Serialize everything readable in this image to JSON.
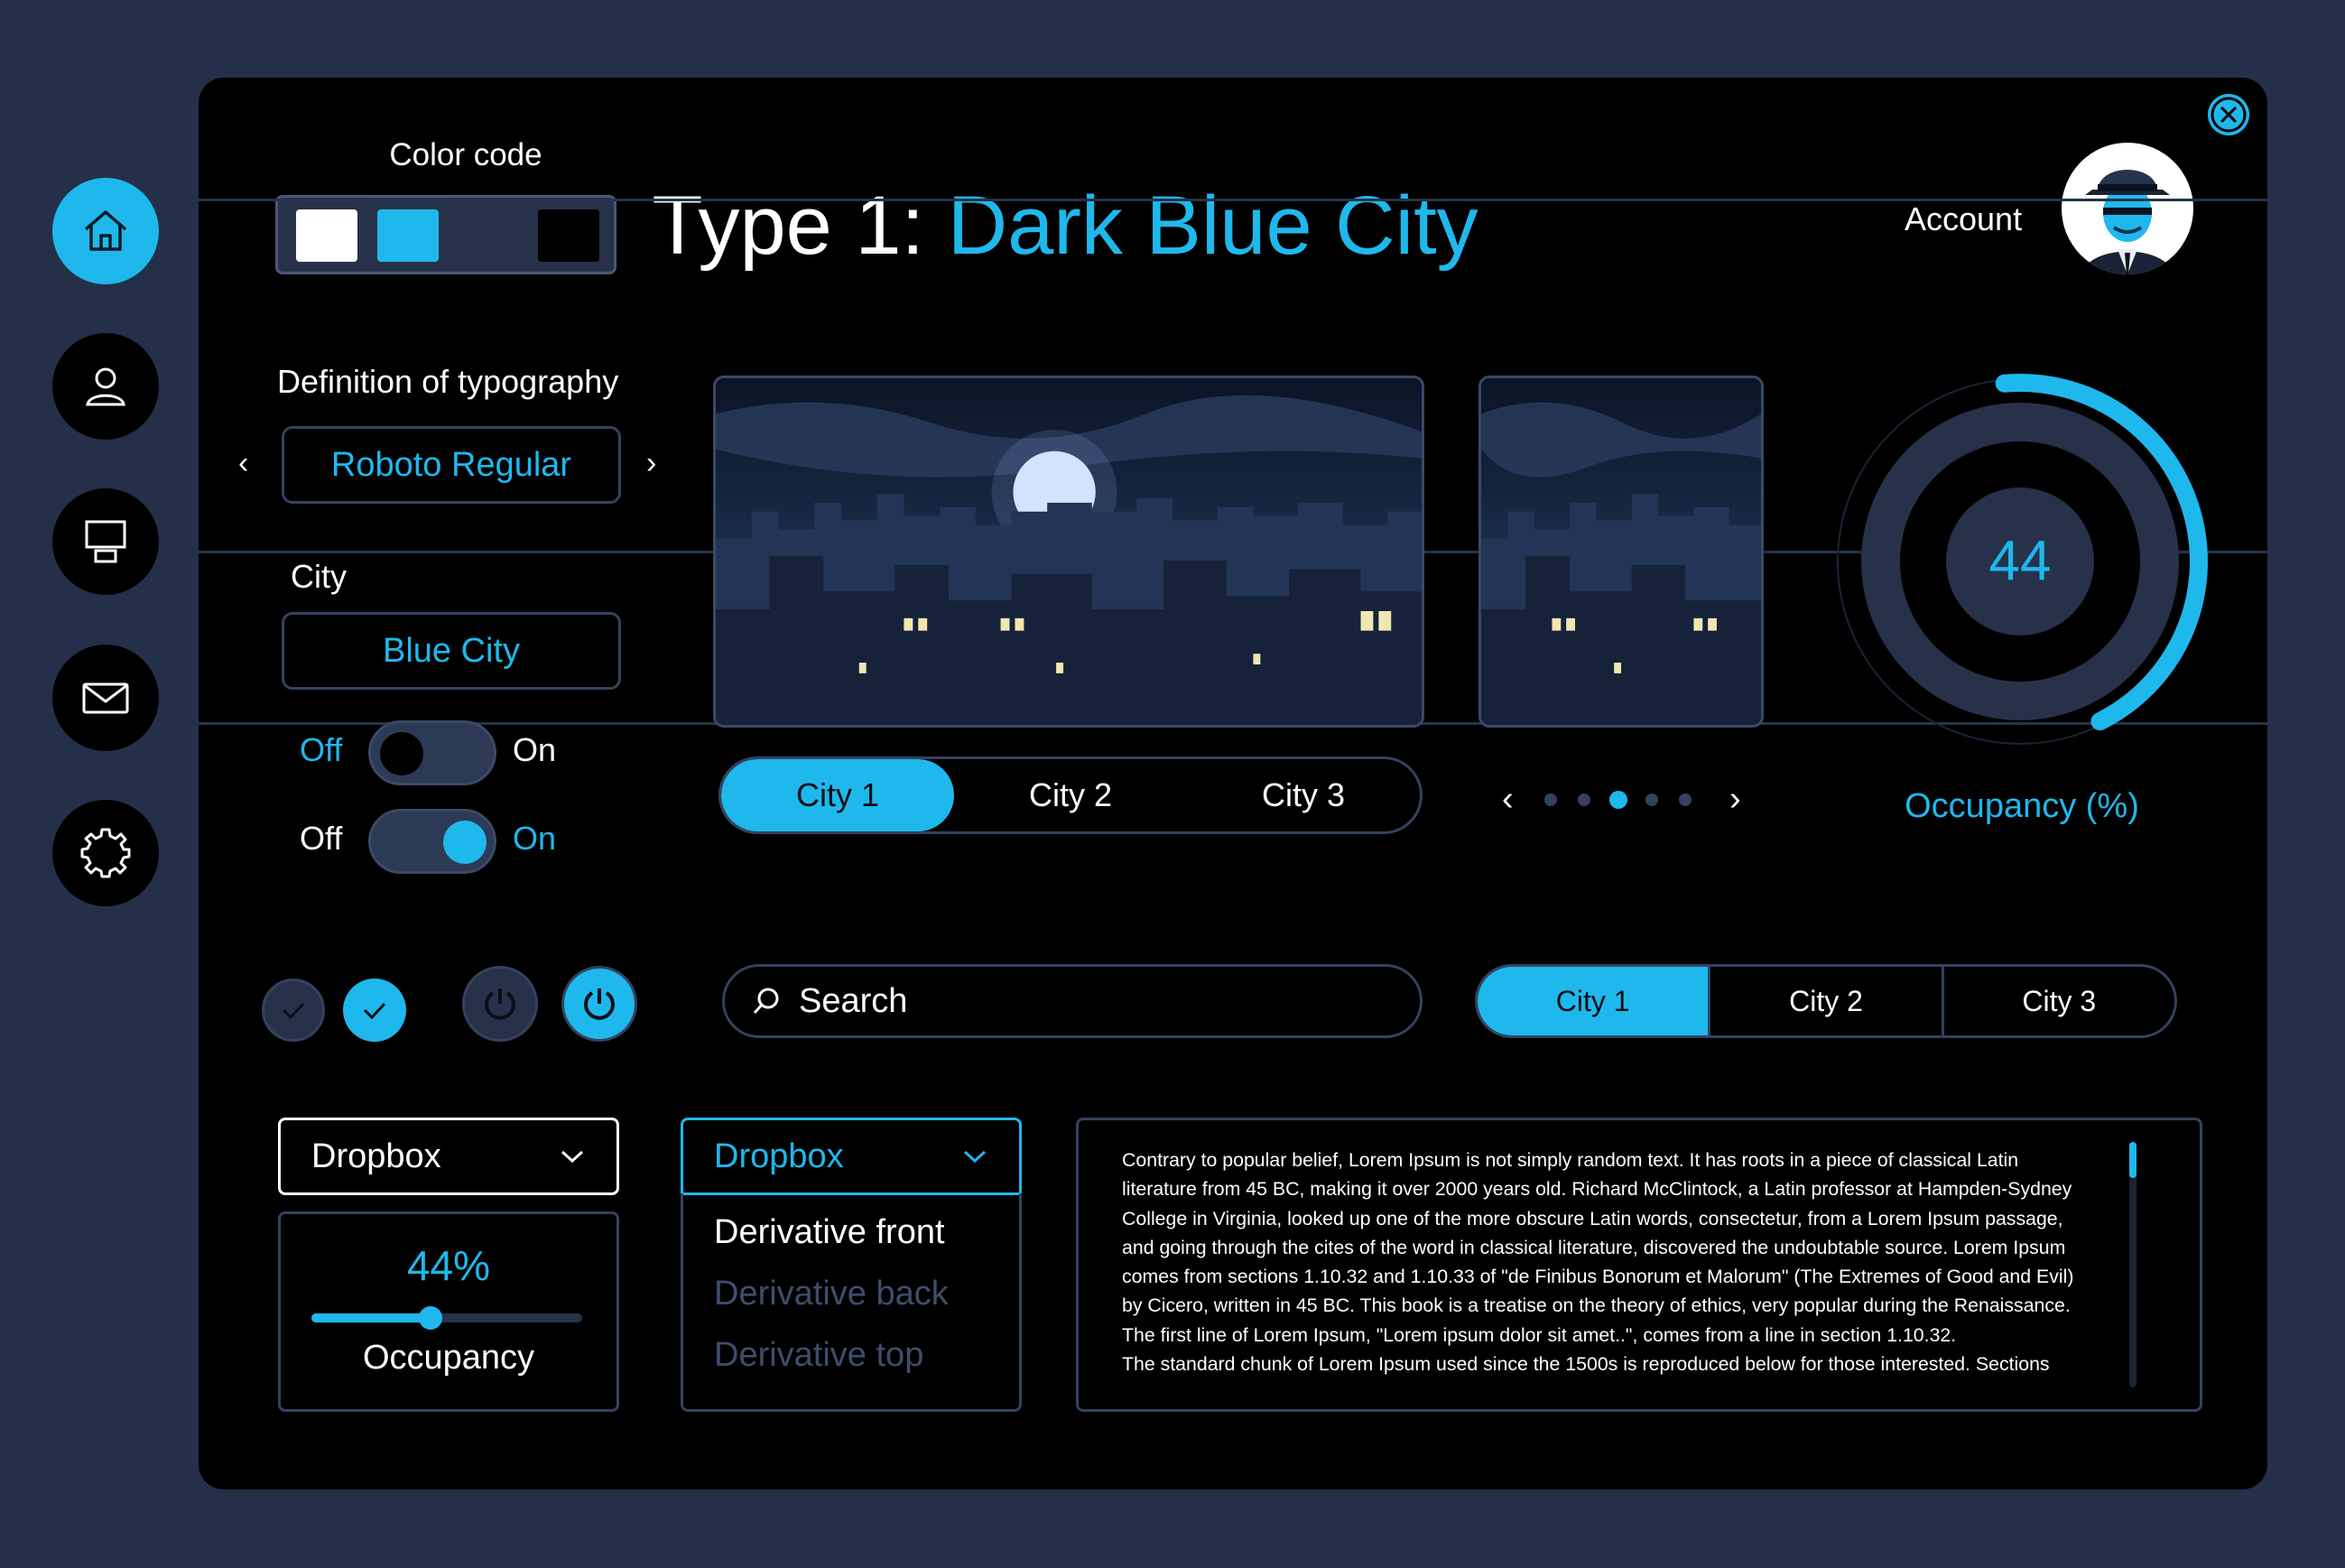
{
  "colors": {
    "accent": "#1fb8ec",
    "background": "#24304a",
    "panel": "#000000",
    "muted": "#34425e"
  },
  "sidebar": {
    "items": [
      {
        "name": "home",
        "icon": "home-icon",
        "active": true
      },
      {
        "name": "profile",
        "icon": "user-icon",
        "active": false
      },
      {
        "name": "presentation",
        "icon": "presentation-icon",
        "active": false
      },
      {
        "name": "mail",
        "icon": "mail-icon",
        "active": false
      },
      {
        "name": "settings",
        "icon": "gear-icon",
        "active": false
      }
    ]
  },
  "header": {
    "color_code_label": "Color code",
    "color_swatches": [
      "#ffffff",
      "#1fb8ec",
      "#1f2a3f",
      "#000000"
    ],
    "title_prefix": "Type 1: ",
    "title_accent": "Dark Blue City",
    "account_label": "Account"
  },
  "typography": {
    "label": "Definition of typography",
    "value": "Roboto Regular",
    "city_label": "City",
    "city_value": "Blue City"
  },
  "toggles": [
    {
      "off": "Off",
      "on": "On",
      "state": false
    },
    {
      "off": "Off",
      "on": "On",
      "state": true
    }
  ],
  "gallery": {
    "tabs": [
      "City 1",
      "City 2",
      "City 3"
    ],
    "active_tab": 0,
    "carousel_dots": 5,
    "carousel_active": 2
  },
  "occupancy_ring": {
    "value": "44",
    "percent": 44,
    "label": "Occupancy (%)"
  },
  "search": {
    "placeholder": "Search"
  },
  "segment_tabs": {
    "tabs": [
      "City 1",
      "City 2",
      "City 3"
    ],
    "active": 0
  },
  "dropbox1": {
    "label": "Dropbox"
  },
  "dropbox2": {
    "label": "Dropbox",
    "options": [
      "Derivative front",
      "Derivative back",
      "Derivative top"
    ],
    "selected": 0
  },
  "slider": {
    "value_text": "44%",
    "percent": 44,
    "label": "Occupancy"
  },
  "text_block": {
    "lines": [
      "Contrary to popular belief, Lorem Ipsum is not simply random text. It has roots in a piece of classical Latin",
      "literature from 45 BC, making it over 2000 years old. Richard McClintock, a Latin professor at Hampden-Sydney",
      "College in Virginia, looked up one of the more obscure Latin words, consectetur, from a Lorem Ipsum passage,",
      "and going through the cites of the word in classical literature, discovered the undoubtable source. Lorem Ipsum",
      "comes from sections 1.10.32 and 1.10.33 of \"de Finibus Bonorum et Malorum\" (The Extremes of Good and Evil)",
      "by Cicero, written in 45 BC. This book is a treatise on the theory of ethics, very popular during the Renaissance.",
      "The first line of Lorem Ipsum, \"Lorem ipsum dolor sit amet..\", comes from a line in section 1.10.32.",
      "The standard chunk of Lorem Ipsum used since the 1500s is reproduced below for those interested. Sections"
    ]
  }
}
